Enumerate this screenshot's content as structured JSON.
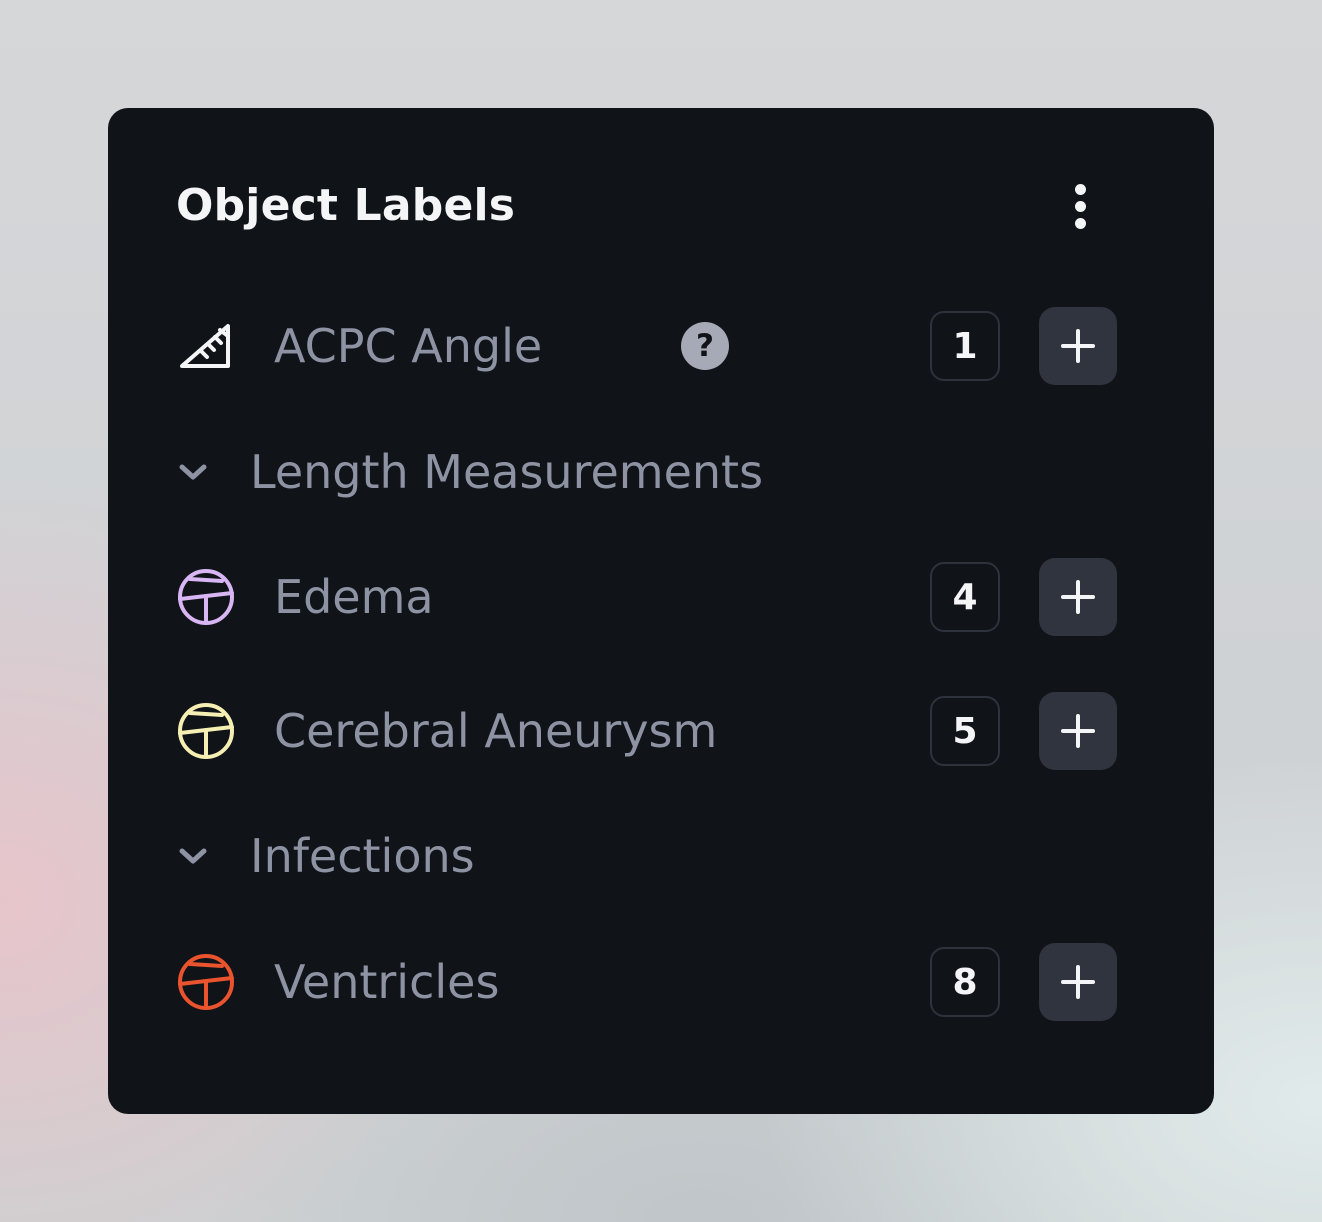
{
  "panel": {
    "title": "Object Labels",
    "menu_icon": "kebab-menu-icon"
  },
  "items": [
    {
      "type": "label",
      "name": "ACPC Angle",
      "icon": "ruler-angle-icon",
      "color": "#f4f5f7",
      "count": "1",
      "help": "?"
    },
    {
      "type": "group",
      "name": "Length Measurements",
      "icon": "chevron-down-icon"
    },
    {
      "type": "label",
      "name": "Edema",
      "icon": "segment-circle-icon",
      "color": "#d8b6f4",
      "count": "4"
    },
    {
      "type": "label",
      "name": "Cerebral Aneurysm",
      "icon": "segment-circle-icon",
      "color": "#f6efb4",
      "count": "5"
    },
    {
      "type": "group",
      "name": "Infections",
      "icon": "chevron-down-icon"
    },
    {
      "type": "label",
      "name": "Ventricles",
      "icon": "segment-circle-icon",
      "color": "#e9532e",
      "count": "8"
    }
  ],
  "colors": {
    "panel_bg": "#101318",
    "label_text": "#8d93a3",
    "add_button_bg": "#2f343e"
  }
}
